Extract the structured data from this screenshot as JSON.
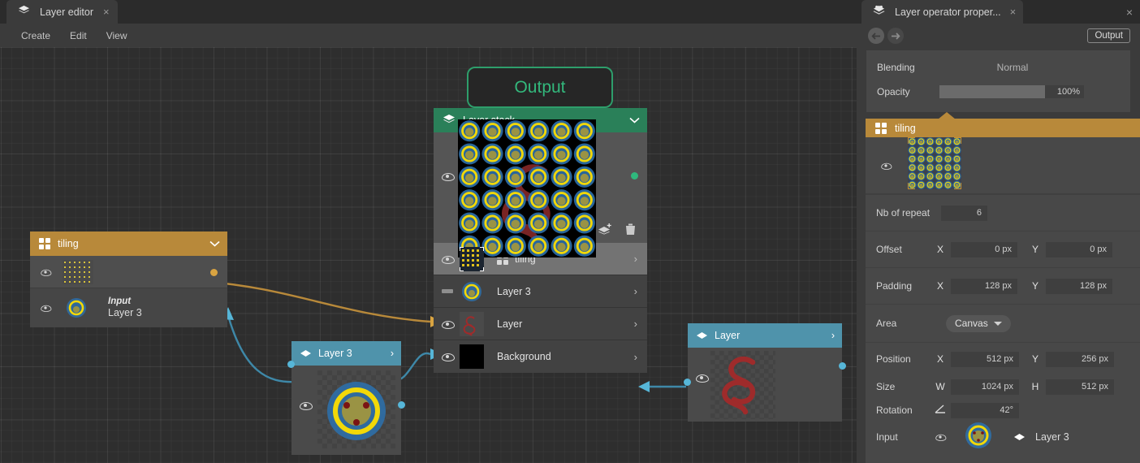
{
  "left_pane": {
    "tab": {
      "title": "Layer editor",
      "icon": "layers-icon",
      "close": "×"
    },
    "menu": [
      "Create",
      "Edit",
      "View"
    ],
    "nodes": {
      "output": {
        "label": "Output",
        "accent": "#33b87c"
      },
      "layer_stack": {
        "title": "Layer stack",
        "icon": "layers-icon",
        "collapse_icon": "chevron-down-icon",
        "header_color": "#2a8059",
        "tools": [
          "mask-icon",
          "merge-layers-icon",
          "add-layer-icon",
          "delete-icon"
        ],
        "rows": [
          {
            "name": "tiling",
            "visibility": "visible",
            "selected": true,
            "op_icon": "grid-icon",
            "chevron": "›"
          },
          {
            "name": "Layer 3",
            "visibility": "hidden",
            "selected": false,
            "op_icon": "",
            "chevron": "›"
          },
          {
            "name": "Layer",
            "visibility": "visible",
            "selected": false,
            "op_icon": "",
            "chevron": "›"
          },
          {
            "name": "Background",
            "visibility": "visible",
            "selected": false,
            "op_icon": "",
            "chevron": "›"
          }
        ]
      },
      "tiling": {
        "title": "tiling",
        "icon": "grid-icon",
        "collapse_icon": "chevron-down-icon",
        "header_color": "#b8893a",
        "input_label": "Input",
        "input_value": "Layer 3"
      },
      "layer3": {
        "title": "Layer 3",
        "icon": "layer-diamond-icon",
        "chevron": "›",
        "header_color": "#4f93ab"
      },
      "layer": {
        "title": "Layer",
        "icon": "layer-diamond-icon",
        "chevron": "›",
        "header_color": "#4f93ab"
      }
    }
  },
  "right_pane": {
    "tab": {
      "title": "Layer operator proper...",
      "icon": "operator-icon",
      "close": "×"
    },
    "window_close": "×",
    "toolbar": {
      "back_icon": "arrow-left-circle-icon",
      "forward_icon": "arrow-right-circle-icon",
      "output_button": "Output"
    },
    "blending": {
      "label": "Blending",
      "value": "Normal"
    },
    "opacity": {
      "label": "Opacity",
      "value": "100%",
      "percent": 100
    },
    "section": {
      "title": "tiling",
      "icon": "grid-icon",
      "header_color": "#b8893a"
    },
    "fields": {
      "nb_of_repeat": {
        "label": "Nb of repeat",
        "value": "6"
      },
      "offset": {
        "label": "Offset",
        "x_axis": "X",
        "x": "0 px",
        "y_axis": "Y",
        "y": "0 px"
      },
      "padding": {
        "label": "Padding",
        "x_axis": "X",
        "x": "128 px",
        "y_axis": "Y",
        "y": "128 px"
      },
      "area": {
        "label": "Area",
        "value": "Canvas",
        "caret": "chevron-down-icon"
      },
      "position": {
        "label": "Position",
        "x_axis": "X",
        "x": "512 px",
        "y_axis": "Y",
        "y": "256 px"
      },
      "size": {
        "label": "Size",
        "w_axis": "W",
        "w": "1024 px",
        "h_axis": "H",
        "h": "512 px"
      },
      "rotation": {
        "label": "Rotation",
        "axis_icon": "angle-icon",
        "value": "42°"
      }
    },
    "input": {
      "label": "Input",
      "visibility": "visible",
      "node_icon": "layer-diamond-icon",
      "node_name": "Layer 3"
    }
  }
}
